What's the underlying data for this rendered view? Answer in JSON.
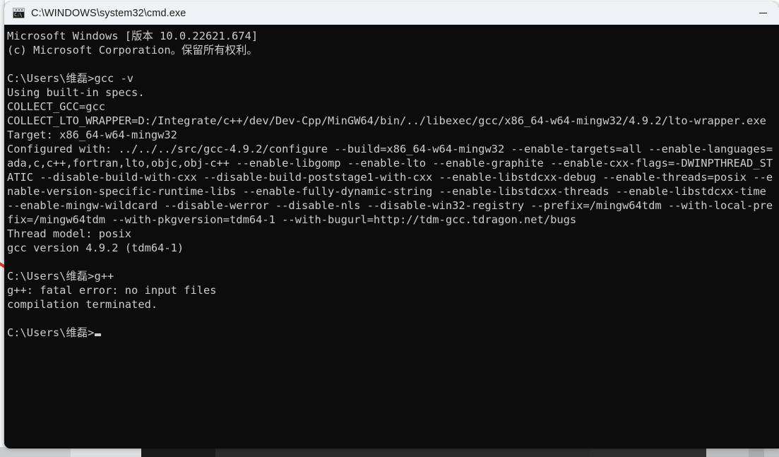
{
  "window": {
    "title": "C:\\WINDOWS\\system32\\cmd.exe",
    "icon": "cmd-console-icon",
    "icon_glyph": "C:\\",
    "minimize_label": "Minimize",
    "background_color": "#0c0c0c",
    "text_color": "#cccccc",
    "titlebar_color": "#eef1f5"
  },
  "console": {
    "lines": [
      "Microsoft Windows [版本 10.0.22621.674]",
      "(c) Microsoft Corporation。保留所有权利。",
      "",
      "C:\\Users\\维磊>gcc -v",
      "Using built-in specs.",
      "COLLECT_GCC=gcc",
      "COLLECT_LTO_WRAPPER=D:/Integrate/c++/dev/Dev-Cpp/MinGW64/bin/../libexec/gcc/x86_64-w64-mingw32/4.9.2/lto-wrapper.exe",
      "Target: x86_64-w64-mingw32",
      "Configured with: ../../../src/gcc-4.9.2/configure --build=x86_64-w64-mingw32 --enable-targets=all --enable-languages=ada,c,c++,fortran,lto,objc,obj-c++ --enable-libgomp --enable-lto --enable-graphite --enable-cxx-flags=-DWINPTHREAD_STATIC --disable-build-with-cxx --disable-build-poststage1-with-cxx --enable-libstdcxx-debug --enable-threads=posix --enable-version-specific-runtime-libs --enable-fully-dynamic-string --enable-libstdcxx-threads --enable-libstdcxx-time --enable-mingw-wildcard --disable-werror --disable-nls --disable-win32-registry --prefix=/mingw64tdm --with-local-prefix=/mingw64tdm --with-pkgversion=tdm64-1 --with-bugurl=http://tdm-gcc.tdragon.net/bugs",
      "Thread model: posix",
      "gcc version 4.9.2 (tdm64-1)",
      "",
      "C:\\Users\\维磊>g++",
      "g++: fatal error: no input files",
      "compilation terminated.",
      "",
      "C:\\Users\\维磊>"
    ],
    "prompt": "C:\\Users\\维磊>",
    "cursor": "block"
  }
}
